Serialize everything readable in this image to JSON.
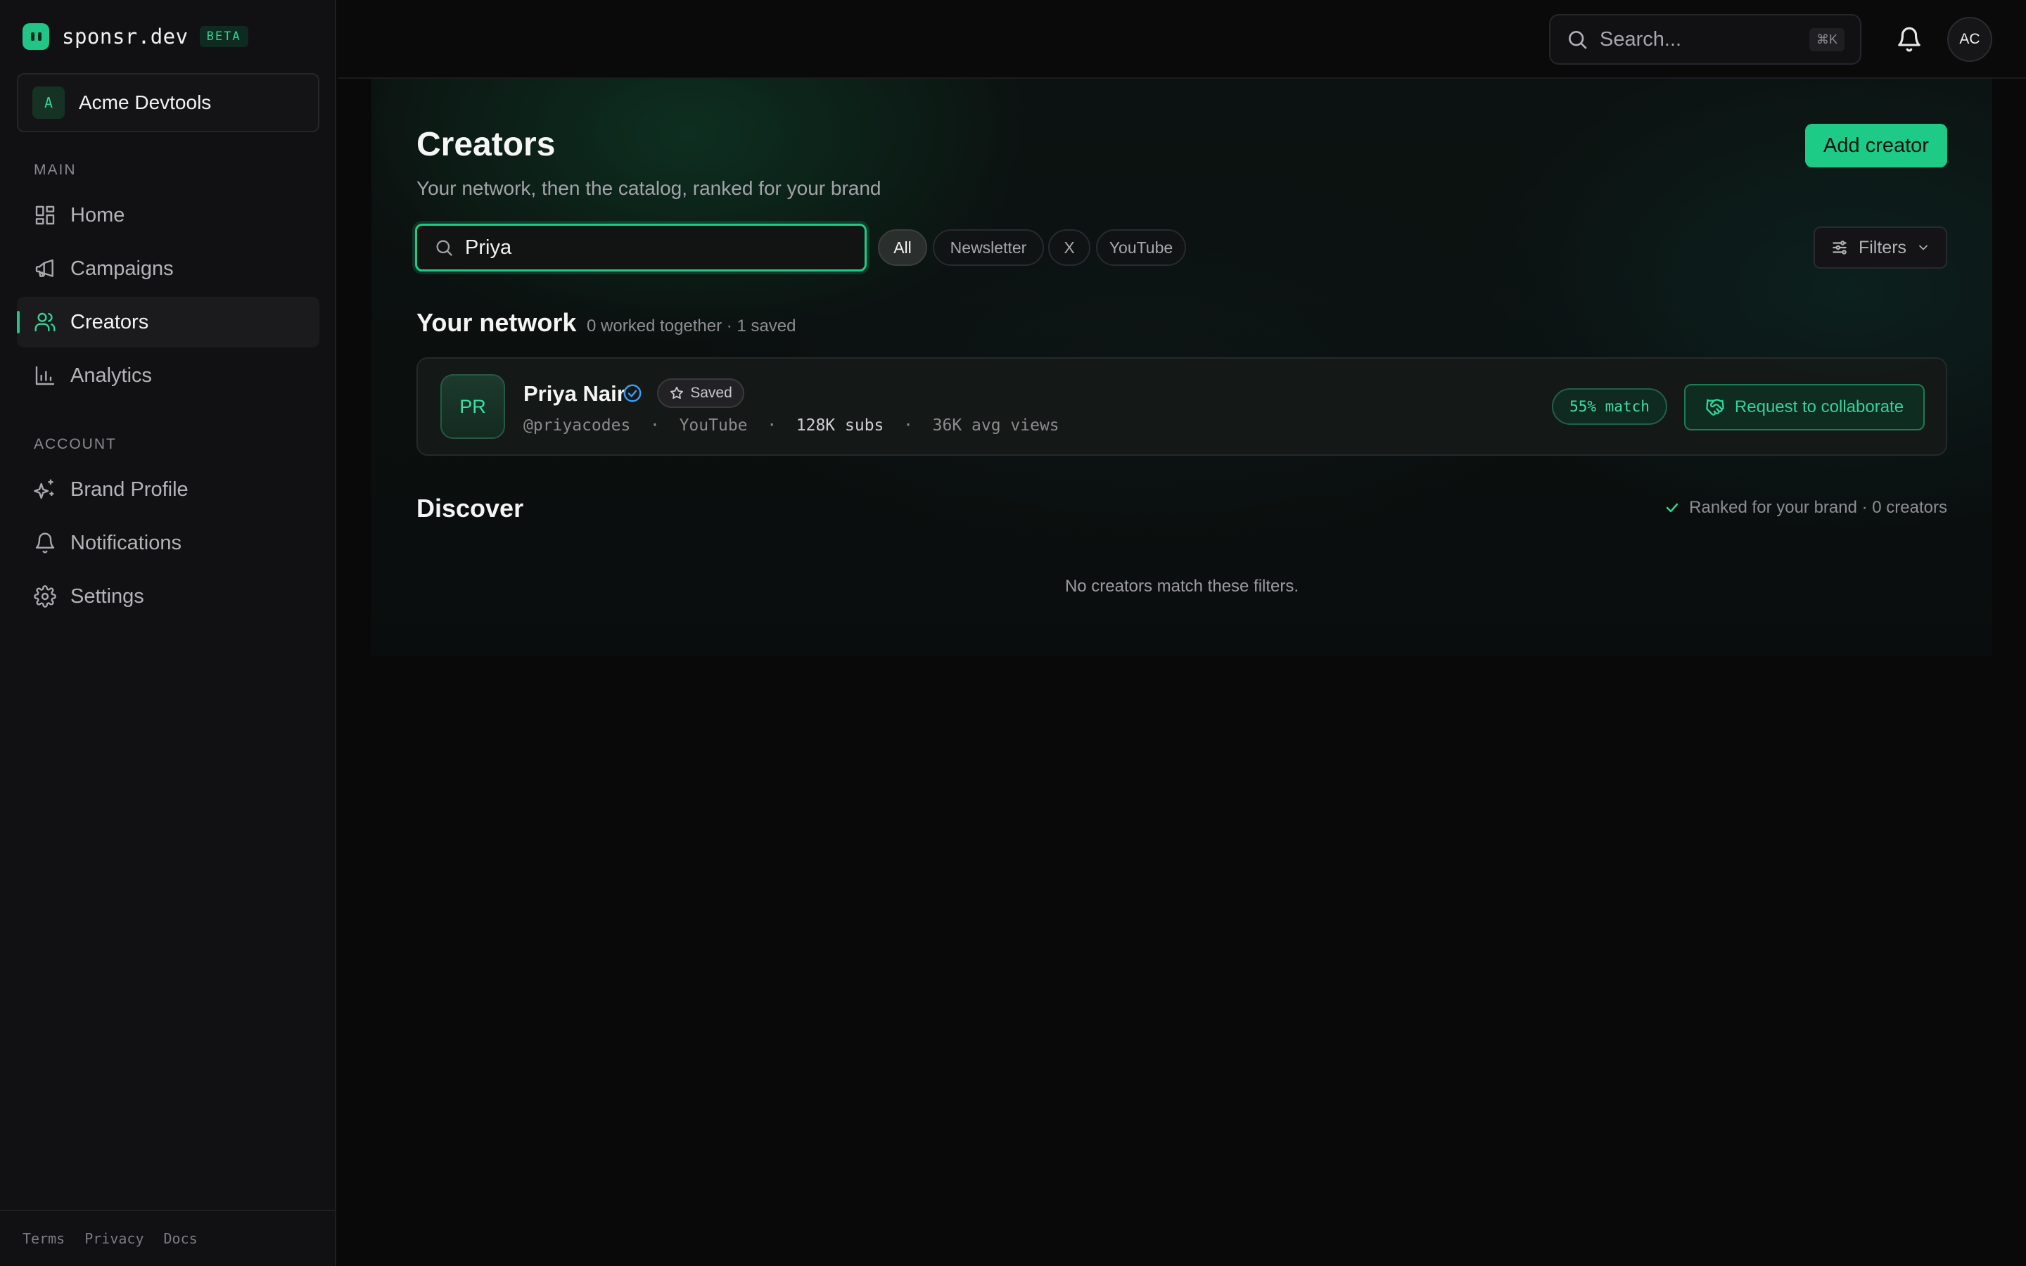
{
  "brand": {
    "name": "sponsr.dev",
    "badge": "BETA"
  },
  "workspace": {
    "initial": "A",
    "name": "Acme Devtools"
  },
  "sidebar": {
    "main_label": "MAIN",
    "main_items": [
      {
        "label": "Home",
        "icon": "grid-icon"
      },
      {
        "label": "Campaigns",
        "icon": "megaphone-icon"
      },
      {
        "label": "Creators",
        "icon": "users-icon",
        "active": true
      },
      {
        "label": "Analytics",
        "icon": "bar-chart-icon"
      }
    ],
    "account_label": "ACCOUNT",
    "account_items": [
      {
        "label": "Brand Profile",
        "icon": "sparkles-icon"
      },
      {
        "label": "Notifications",
        "icon": "bell-icon"
      },
      {
        "label": "Settings",
        "icon": "gear-icon"
      }
    ],
    "footer_links": [
      "Terms",
      "Privacy",
      "Docs"
    ]
  },
  "topbar": {
    "search_placeholder": "Search...",
    "shortcut": "⌘K",
    "avatar_initials": "AC"
  },
  "page": {
    "title": "Creators",
    "subtitle": "Your network, then the catalog, ranked for your brand",
    "add_button": "Add creator",
    "search_value": "Priya",
    "filter_chips": [
      {
        "label": "All",
        "active": true
      },
      {
        "label": "Newsletter"
      },
      {
        "label": "X"
      },
      {
        "label": "YouTube"
      }
    ],
    "filters_button": "Filters"
  },
  "network": {
    "heading": "Your network",
    "meta": "0 worked together · 1 saved",
    "creators": [
      {
        "initials": "PR",
        "name": "Priya Nair",
        "verified": true,
        "saved_label": "Saved",
        "handle": "@priyacodes",
        "platform": "YouTube",
        "subs": "128K subs",
        "avg_views": "36K avg views",
        "match": "55% match",
        "action": "Request to collaborate"
      }
    ]
  },
  "discover": {
    "heading": "Discover",
    "ranked_text": "Ranked for your brand · 0 creators",
    "empty_text": "No creators match these filters."
  },
  "colors": {
    "accent": "#1ecb86",
    "background": "#09090a",
    "sidebar": "#111113"
  }
}
